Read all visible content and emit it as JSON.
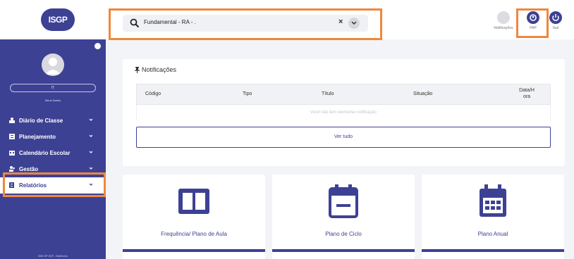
{
  "brand": {
    "logo_text": "ISGP",
    "primary": "#3d4194",
    "highlight": "#f0873c"
  },
  "search": {
    "value": "Fundamental - RA - .",
    "clear": "×",
    "icon": "search-icon"
  },
  "header": {
    "buttons": [
      {
        "label": "Notificações",
        "icon": "bell-icon"
      },
      {
        "label": "PAP",
        "icon": "user-badge-icon"
      },
      {
        "label": "Sair",
        "icon": "power-icon"
      }
    ]
  },
  "sidebar": {
    "user_name": "IT",
    "my_data": "Meus Dados",
    "items": [
      {
        "label": "Diário de Classe",
        "icon": "teacher-icon"
      },
      {
        "label": "Planejamento",
        "icon": "list-icon"
      },
      {
        "label": "Calendário Escolar",
        "icon": "calendar-icon"
      },
      {
        "label": "Gestão",
        "icon": "users-icon"
      },
      {
        "label": "Relatórios",
        "icon": "report-icon"
      }
    ],
    "footer": "SME-SP-SGP - Distribuído"
  },
  "notifications": {
    "title": "Notificações",
    "columns": [
      "Código",
      "Tipo",
      "Título",
      "Situação",
      "Data/H ora"
    ],
    "empty": "Você não tem nenhuma notificação",
    "see_all": "Ver tudo"
  },
  "tiles": [
    {
      "label": "Frequência/ Plano de Aula",
      "icon": "columns-icon"
    },
    {
      "label": "Plano de Ciclo",
      "icon": "calendar-minus-icon"
    },
    {
      "label": "Plano Anual",
      "icon": "calendar-grid-icon"
    }
  ]
}
